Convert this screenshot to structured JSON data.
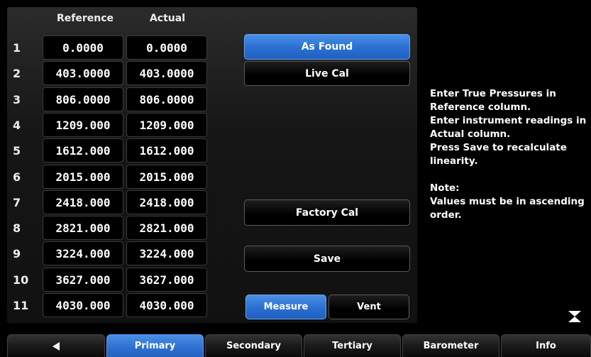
{
  "table": {
    "headers": {
      "reference": "Reference",
      "actual": "Actual"
    },
    "rows": [
      {
        "num": "1",
        "reference": "0.0000",
        "actual": "0.0000"
      },
      {
        "num": "2",
        "reference": "403.0000",
        "actual": "403.0000"
      },
      {
        "num": "3",
        "reference": "806.0000",
        "actual": "806.0000"
      },
      {
        "num": "4",
        "reference": "1209.000",
        "actual": "1209.000"
      },
      {
        "num": "5",
        "reference": "1612.000",
        "actual": "1612.000"
      },
      {
        "num": "6",
        "reference": "2015.000",
        "actual": "2015.000"
      },
      {
        "num": "7",
        "reference": "2418.000",
        "actual": "2418.000"
      },
      {
        "num": "8",
        "reference": "2821.000",
        "actual": "2821.000"
      },
      {
        "num": "9",
        "reference": "3224.000",
        "actual": "3224.000"
      },
      {
        "num": "10",
        "reference": "3627.000",
        "actual": "3627.000"
      },
      {
        "num": "11",
        "reference": "4030.000",
        "actual": "4030.000"
      }
    ]
  },
  "buttons": {
    "as_found": "As Found",
    "live_cal": "Live Cal",
    "factory_cal": "Factory Cal",
    "save": "Save",
    "measure": "Measure",
    "vent": "Vent"
  },
  "info": {
    "lines": [
      "Enter True Pressures in Reference column.",
      "Enter instrument readings in Actual column.",
      "Press Save to recalculate linearity."
    ],
    "note_title": "Note:",
    "note_text": "Values must be in ascending order."
  },
  "tabs": [
    {
      "label": "",
      "icon": "back-arrow-icon"
    },
    {
      "label": "Primary",
      "active": true
    },
    {
      "label": "Secondary"
    },
    {
      "label": "Tertiary"
    },
    {
      "label": "Barometer"
    },
    {
      "label": "Info"
    }
  ],
  "colors": {
    "accent": "#2a6fd0",
    "background": "#000000"
  }
}
